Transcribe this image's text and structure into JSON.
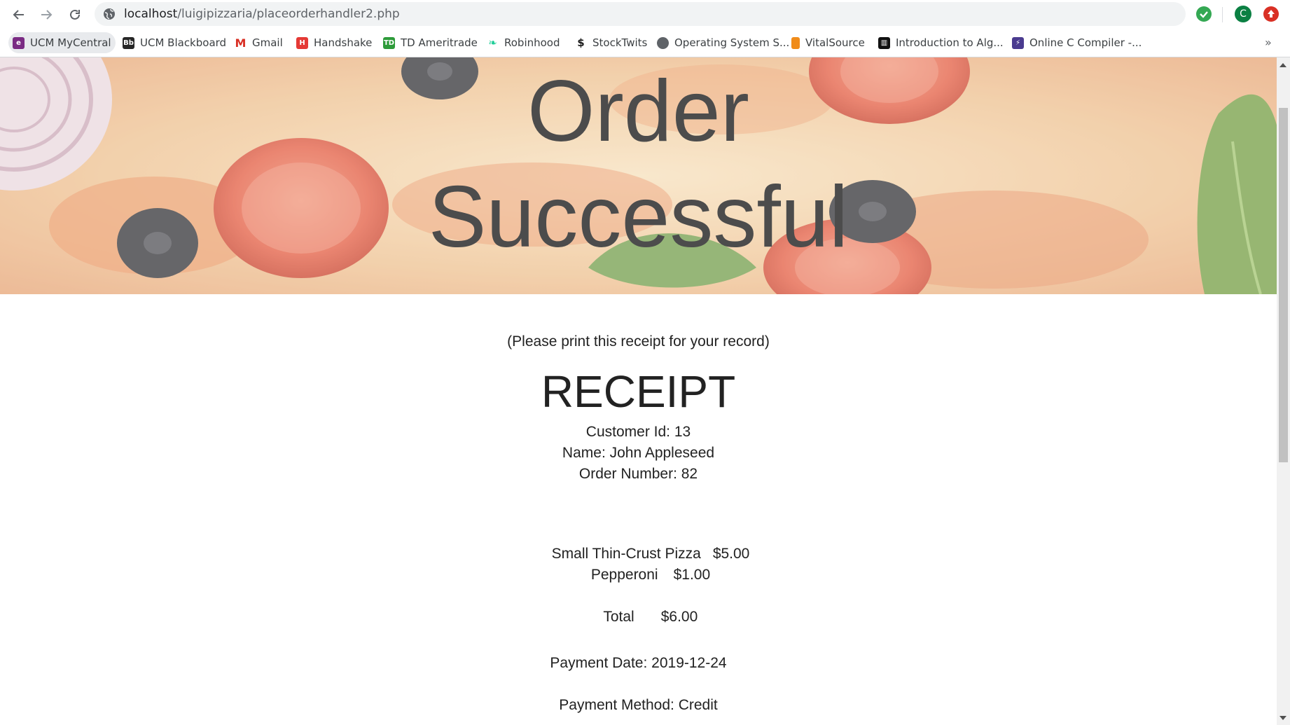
{
  "browser": {
    "url_host": "localhost",
    "url_path": "/luigipizzaria/placeorderhandler2.php",
    "profile_initial": "C",
    "bookmarks": [
      {
        "label": "UCM MyCentral",
        "icon": "ucm-mycentral-icon",
        "color": "#7a2b83"
      },
      {
        "label": "UCM Blackboard",
        "icon": "blackboard-icon",
        "color": "#262626"
      },
      {
        "label": "Gmail",
        "icon": "gmail-icon",
        "color": "#d93025"
      },
      {
        "label": "Handshake",
        "icon": "handshake-icon",
        "color": "#e53935"
      },
      {
        "label": "TD Ameritrade",
        "icon": "td-ameritrade-icon",
        "color": "#2e9b3a"
      },
      {
        "label": "Robinhood",
        "icon": "robinhood-icon",
        "color": "#21ce99"
      },
      {
        "label": "StockTwits",
        "icon": "stocktwits-icon",
        "color": "#1a1a1a"
      },
      {
        "label": "Operating System S...",
        "icon": "operating-system-icon",
        "color": "#5f6368"
      },
      {
        "label": "VitalSource",
        "icon": "vitalsource-icon",
        "color": "#f08c1a"
      },
      {
        "label": "Introduction to Alg...",
        "icon": "introduction-to-algorithms-icon",
        "color": "#111111"
      },
      {
        "label": "Online C Compiler -...",
        "icon": "online-c-compiler-icon",
        "color": "#4a3b8f"
      }
    ],
    "more_label": "»"
  },
  "page": {
    "hero_title_line1": "Order",
    "hero_title_line2": "Successful",
    "print_note": "(Please print this receipt for your record)",
    "receipt_heading": "RECEIPT",
    "customer_id": "Customer Id: 13",
    "name": "Name: John Appleseed",
    "order_number": "Order Number: 82",
    "items": [
      {
        "name": "Small Thin-Crust Pizza",
        "price": "$5.00"
      },
      {
        "name": "Pepperoni",
        "price": "$1.00"
      }
    ],
    "total_label": "Total",
    "total_value": "$6.00",
    "payment_date": "Payment Date: 2019-12-24",
    "payment_method": "Payment Method: Credit"
  },
  "colors": {
    "hero_title": "#4c4c4c",
    "text": "#222222"
  }
}
